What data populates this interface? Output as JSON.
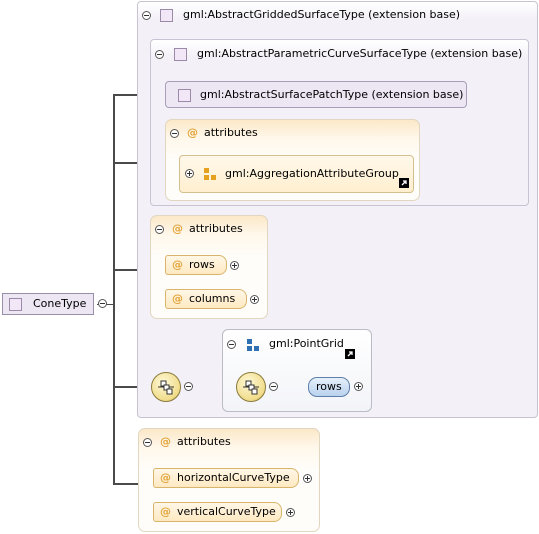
{
  "root": {
    "label": "ConeType"
  },
  "ext_gridded": {
    "label": "gml:AbstractGriddedSurfaceType (extension base)"
  },
  "ext_parametric": {
    "label": "gml:AbstractParametricCurveSurfaceType (extension base)"
  },
  "ext_patch": {
    "label": "gml:AbstractSurfacePatchType (extension base)"
  },
  "attrs_inner": {
    "title": "attributes",
    "group": "gml:AggregationAttributeGroup"
  },
  "attrs_mid": {
    "title": "attributes",
    "items": [
      "rows",
      "columns"
    ]
  },
  "pointgrid": {
    "label": "gml:PointGrid",
    "child": "rows"
  },
  "attrs_bottom": {
    "title": "attributes",
    "items": [
      "horizontalCurveType",
      "verticalCurveType"
    ]
  },
  "symbols": {
    "attribute": "@"
  },
  "colors": {
    "element_fill": "#ece7f2",
    "attribute_fill": "#ffe9c2",
    "extension_fill": "#f5f2f9",
    "element_blue": "#c8dcf4"
  }
}
